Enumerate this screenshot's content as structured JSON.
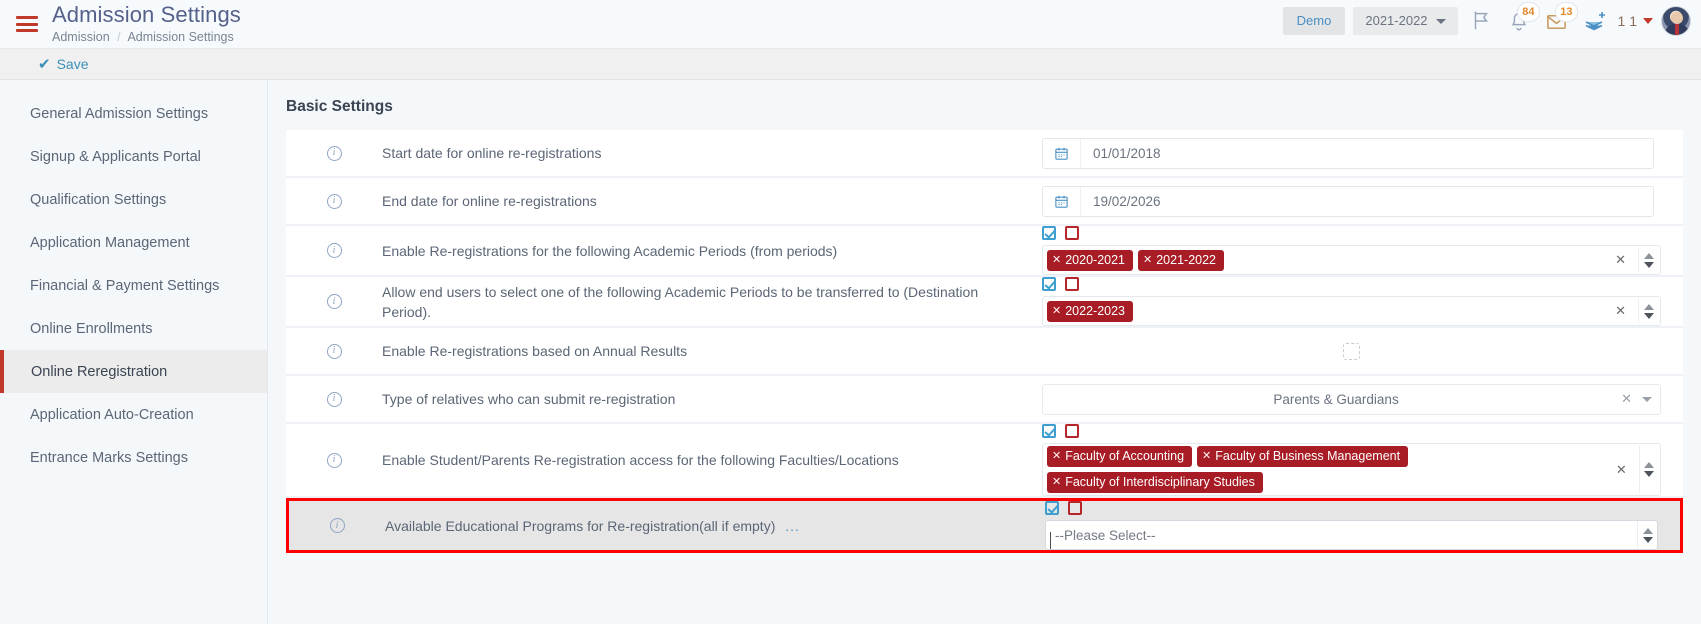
{
  "header": {
    "menu_icon": "hamburger-icon",
    "title": "Admission Settings",
    "breadcrumb_parent": "Admission",
    "breadcrumb_sep": "/",
    "breadcrumb_current": "Admission Settings",
    "demo_label": "Demo",
    "academic_year": "2021-2022",
    "flag_icon": "flag-icon",
    "bell_icon": "bell-icon",
    "bell_badge": "84",
    "mail_icon": "envelope-icon",
    "mail_badge": "13",
    "layers_icon": "layers-plus-icon",
    "language": "1 1",
    "avatar": "user-avatar"
  },
  "toolbar": {
    "save_label": "Save",
    "save_icon": "check-icon"
  },
  "sidebar": {
    "items": [
      {
        "label": "General Admission Settings",
        "active": false
      },
      {
        "label": "Signup & Applicants Portal",
        "active": false
      },
      {
        "label": "Qualification Settings",
        "active": false
      },
      {
        "label": "Application Management",
        "active": false
      },
      {
        "label": "Financial & Payment Settings",
        "active": false
      },
      {
        "label": "Online Enrollments",
        "active": false
      },
      {
        "label": "Online Reregistration",
        "active": true
      },
      {
        "label": "Application Auto-Creation",
        "active": false
      },
      {
        "label": "Entrance Marks Settings",
        "active": false
      }
    ]
  },
  "main": {
    "section_title": "Basic Settings",
    "rows": [
      {
        "info_icon": "info-icon",
        "label": "Start date for online re-registrations",
        "field_type": "date",
        "value": "01/01/2018",
        "calendar_icon": "calendar-icon"
      },
      {
        "info_icon": "info-icon",
        "label": "End date for online re-registrations",
        "field_type": "date",
        "value": "19/02/2026",
        "calendar_icon": "calendar-icon"
      },
      {
        "info_icon": "info-icon",
        "label": "Enable Re-registrations for the following Academic Periods (from periods)",
        "field_type": "multiselect",
        "select_all_icon": "checkbox-checked-icon",
        "select_none_icon": "checkbox-empty-icon",
        "tags": [
          "2020-2021",
          "2021-2022"
        ],
        "clear_icon": "clear-x-icon",
        "spinner_icon": "spinner-arrows-icon"
      },
      {
        "info_icon": "info-icon",
        "label": "Allow end users to select one of the following Academic Periods to be transferred to (Destination Period).",
        "field_type": "multiselect",
        "select_all_icon": "checkbox-checked-icon",
        "select_none_icon": "checkbox-empty-icon",
        "tags": [
          "2022-2023"
        ],
        "clear_icon": "clear-x-icon",
        "spinner_icon": "spinner-arrows-icon"
      },
      {
        "info_icon": "info-icon",
        "label": "Enable Re-registrations based on Annual Results",
        "field_type": "checkbox",
        "checked": false
      },
      {
        "info_icon": "info-icon",
        "label": "Type of relatives who can submit re-registration",
        "field_type": "select",
        "value": "Parents & Guardians",
        "clear_icon": "clear-x-icon",
        "caret_icon": "chevron-down-icon"
      },
      {
        "info_icon": "info-icon",
        "label": "Enable Student/Parents Re-registration access for the following Faculties/Locations",
        "field_type": "multiselect",
        "select_all_icon": "checkbox-checked-icon",
        "select_none_icon": "checkbox-empty-icon",
        "tags": [
          "Faculty of Accounting",
          "Faculty of Business Management",
          "Faculty of Interdisciplinary Studies"
        ],
        "clear_icon": "clear-x-icon",
        "spinner_icon": "spinner-arrows-icon"
      },
      {
        "info_icon": "info-icon",
        "label": "Available Educational Programs for Re-registration(all if empty)",
        "label_suffix": "...",
        "field_type": "please-select",
        "select_all_icon": "checkbox-checked-icon",
        "select_none_icon": "checkbox-empty-icon",
        "placeholder": "--Please Select--",
        "spinner_icon": "spinner-arrows-icon",
        "highlighted": true
      }
    ]
  },
  "colors": {
    "accent_red": "#c0392b",
    "tag_red": "#a81c25",
    "highlight_red": "#ff0000",
    "link_blue": "#3d8fb8",
    "sidebar_bg": "#f5f8fb"
  }
}
